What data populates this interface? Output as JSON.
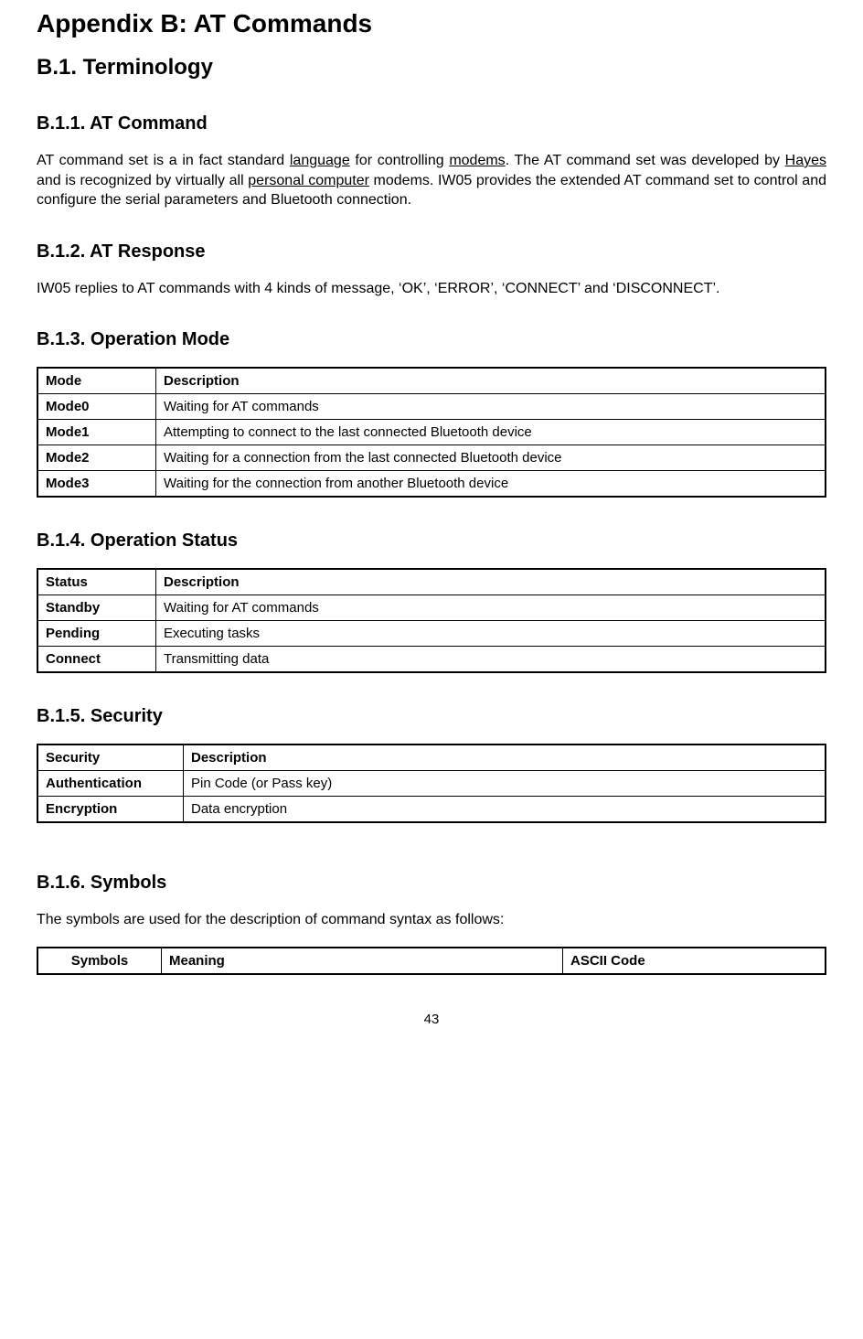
{
  "title": "Appendix B: AT Commands",
  "h2_1": "B.1. Terminology",
  "sec1": {
    "heading": "B.1.1. AT Command",
    "p_pre1": "AT command set is a in fact standard ",
    "link1": "language",
    "p_mid1": " for controlling ",
    "link2": "modems",
    "p_mid2": ". The AT command set was developed by ",
    "link3": "Hayes",
    "p_mid3": " and is recognized by virtually all ",
    "link4": "personal computer",
    "p_post": " modems. IW05 provides the extended AT command set to control and configure the serial parameters and Bluetooth connection."
  },
  "sec2": {
    "heading": "B.1.2. AT Response",
    "p": "IW05 replies to AT commands with 4 kinds of message, ‘OK’, ‘ERROR’, ‘CONNECT’ and ‘DISCONNECT’."
  },
  "sec3": {
    "heading": "B.1.3. Operation Mode",
    "th1": "Mode",
    "th2": "Description",
    "rows": [
      {
        "c1": "Mode0",
        "c2": "Waiting for AT commands"
      },
      {
        "c1": "Mode1",
        "c2": "Attempting to connect to the last connected Bluetooth device"
      },
      {
        "c1": "Mode2",
        "c2": "Waiting for a connection from the last connected Bluetooth device"
      },
      {
        "c1": "Mode3",
        "c2": "Waiting for the connection from another Bluetooth device"
      }
    ]
  },
  "sec4": {
    "heading": "B.1.4. Operation Status",
    "th1": "Status",
    "th2": "Description",
    "rows": [
      {
        "c1": "Standby",
        "c2": "Waiting for AT commands"
      },
      {
        "c1": "Pending",
        "c2": "Executing tasks"
      },
      {
        "c1": "Connect",
        "c2": "Transmitting data"
      }
    ]
  },
  "sec5": {
    "heading": "B.1.5. Security",
    "th1": "Security",
    "th2": "Description",
    "rows": [
      {
        "c1": "Authentication",
        "c2": "Pin Code (or Pass key)"
      },
      {
        "c1": "Encryption",
        "c2": "Data encryption"
      }
    ]
  },
  "sec6": {
    "heading": "B.1.6. Symbols",
    "p": "The symbols are used for the description of command syntax as follows:",
    "th1": "Symbols",
    "th2": "Meaning",
    "th3": "ASCII Code"
  },
  "page_number": "43"
}
